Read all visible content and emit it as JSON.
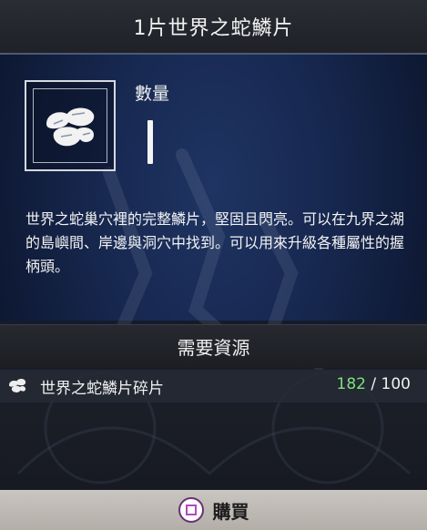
{
  "title": "1片世界之蛇鱗片",
  "item": {
    "icon": "snake-scale-icon",
    "quantity_label": "數量"
  },
  "description": "世界之蛇巢穴裡的完整鱗片，堅固且閃亮。可以在九界之湖的島嶼間、岸邊與洞穴中找到。可以用來升級各種屬性的握柄頭。",
  "requirements": {
    "header": "需要資源",
    "items": [
      {
        "icon": "snake-scale-fragment-icon",
        "name": "世界之蛇鱗片碎片",
        "have": "182",
        "separator": "/",
        "need": "100",
        "have_color": "#7ee07a"
      }
    ]
  },
  "footer": {
    "button_icon": "square-button-icon",
    "buy_label": "購買"
  }
}
